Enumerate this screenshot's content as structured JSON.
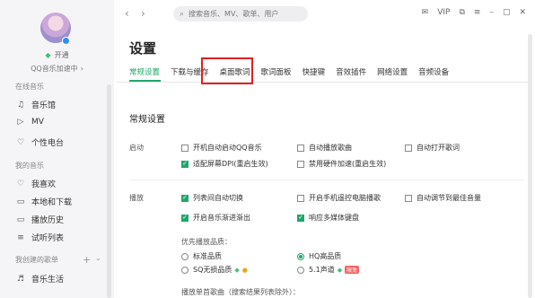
{
  "sidebar": {
    "open_label": "开通",
    "level_label": "QQ音乐加速中",
    "sections": {
      "online": "在线音乐",
      "mine": "我的音乐",
      "created": "我创建的歌单"
    },
    "items": [
      {
        "label": "音乐馆",
        "icon": "music-hall-icon"
      },
      {
        "label": "MV",
        "icon": "mv-icon"
      },
      {
        "label": "个性电台",
        "icon": "radio-icon"
      },
      {
        "label": "我喜欢",
        "icon": "heart-icon"
      },
      {
        "label": "本地和下载",
        "icon": "download-icon"
      },
      {
        "label": "播放历史",
        "icon": "history-icon"
      },
      {
        "label": "试听列表",
        "icon": "list-icon"
      },
      {
        "label": "音乐生活",
        "icon": "playlist-icon"
      }
    ]
  },
  "topbar": {
    "search_placeholder": "搜索音乐、MV、歌单、用户",
    "vip_label": "VIP"
  },
  "settings": {
    "title": "设置",
    "tabs": [
      "常规设置",
      "下载与缓存",
      "桌面歌词",
      "歌词面板",
      "快捷键",
      "音效插件",
      "网络设置",
      "音频设备"
    ],
    "active_tab": "常规设置",
    "highlight_tab": "桌面歌词",
    "section_title": "常规设置",
    "startup": {
      "label": "启动",
      "options": [
        {
          "label": "开机自动启动QQ音乐",
          "checked": false
        },
        {
          "label": "自动播放歌曲",
          "checked": false
        },
        {
          "label": "自动打开歌词",
          "checked": false
        },
        {
          "label": "适配屏幕DPI(重启生效)",
          "checked": true
        },
        {
          "label": "禁用硬件加速(重启生效)",
          "checked": false
        }
      ]
    },
    "playback": {
      "label": "播放",
      "options": [
        {
          "label": "列表间自动切换",
          "checked": true
        },
        {
          "label": "开启手机遥控电脑播歌",
          "checked": false
        },
        {
          "label": "自动调节到最佳音量",
          "checked": false
        },
        {
          "label": "开启音乐渐进渐出",
          "checked": true
        },
        {
          "label": "响应多媒体键盘",
          "checked": true
        }
      ],
      "quality_heading": "优先播放品质：",
      "qualities": [
        {
          "label": "标准品质",
          "checked": false
        },
        {
          "label": "HQ高品质",
          "checked": true
        },
        {
          "label": "SQ无损品质",
          "checked": false
        },
        {
          "label": "5.1声道",
          "checked": false,
          "tag": "限免"
        }
      ],
      "single_song_heading": "播放单首歌曲（搜索结果列表除外）："
    }
  },
  "colors": {
    "accent": "#1fa76c",
    "highlight": "#e02020"
  }
}
